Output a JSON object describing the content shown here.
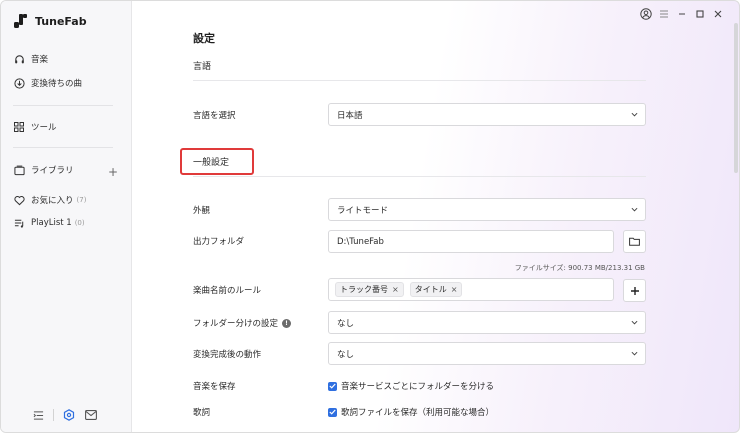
{
  "app": {
    "name": "TuneFab"
  },
  "sidebar": {
    "items": [
      {
        "label": "音楽",
        "icon": "headphones-icon"
      },
      {
        "label": "変換待ちの曲",
        "icon": "download-circle-icon"
      },
      {
        "label": "ツール",
        "icon": "grid-icon"
      },
      {
        "label": "ライブラリ",
        "icon": "library-icon"
      },
      {
        "label": "お気に入り",
        "count": "(7)",
        "icon": "heart-icon"
      },
      {
        "label": "PlayList 1",
        "count": "(0)",
        "icon": "playlist-icon"
      }
    ],
    "add_symbol": "+"
  },
  "page": {
    "title": "設定",
    "language_section": "言語",
    "general_section": "一般設定"
  },
  "settings": {
    "language": {
      "label": "言語を選択",
      "value": "日本語"
    },
    "appearance": {
      "label": "外観",
      "value": "ライトモード"
    },
    "output_folder": {
      "label": "出力フォルダ",
      "value": "D:\\TuneFab"
    },
    "file_size": "ファイルサイズ: 900.73 MB/213.31 GB",
    "naming_rule": {
      "label": "楽曲名前のルール",
      "tags": [
        "トラック番号",
        "タイトル"
      ],
      "tag_remove": "×"
    },
    "folder_split": {
      "label": "フォルダー分けの設定",
      "value": "なし",
      "info": "!"
    },
    "after_convert": {
      "label": "変換完成後の動作",
      "value": "なし"
    },
    "save_music": {
      "label": "音楽を保存",
      "option": "音楽サービスごとにフォルダーを分ける",
      "checked": true
    },
    "lyrics": {
      "label": "歌詞",
      "option": "歌詞ファイルを保存（利用可能な場合）",
      "checked": true
    }
  },
  "colors": {
    "accent": "#2f6fe0",
    "highlight_box": "#e03a3a"
  }
}
